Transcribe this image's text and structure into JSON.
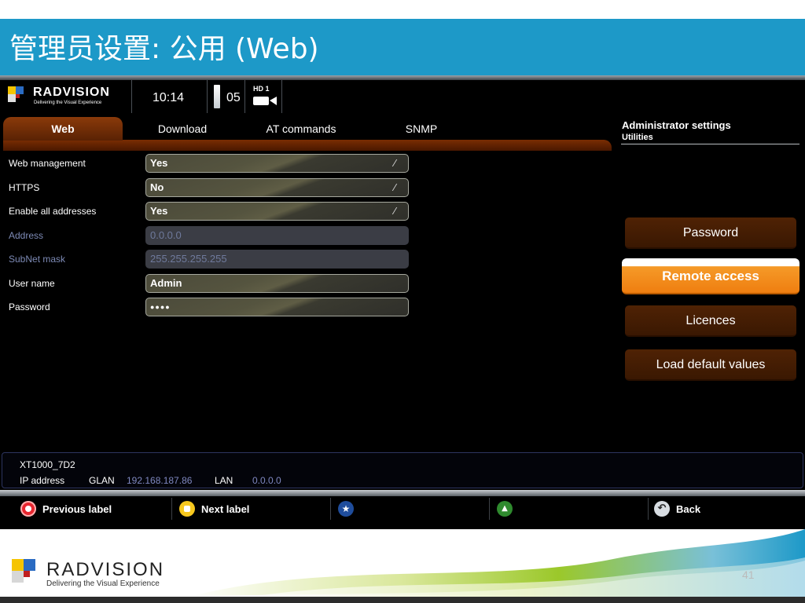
{
  "slide": {
    "title": "管理员设置: 公用 (Web)",
    "page_number": "41",
    "footer_logo": "RADVISION",
    "footer_tagline": "Delivering the Visual Experience"
  },
  "header": {
    "logo": "RADVISION",
    "tagline": "Delivering the Visual Experience",
    "time": "10:14",
    "channel": "05",
    "hd_label": "HD 1"
  },
  "tabs": [
    {
      "label": "Web",
      "active": true
    },
    {
      "label": "Download",
      "active": false
    },
    {
      "label": "AT commands",
      "active": false
    },
    {
      "label": "SNMP",
      "active": false
    }
  ],
  "admin": {
    "title": "Administrator settings",
    "subtitle": "Utilities"
  },
  "form": [
    {
      "label": "Web management",
      "value": "Yes",
      "dropdown": true,
      "disabled": false
    },
    {
      "label": "HTTPS",
      "value": "No",
      "dropdown": true,
      "disabled": false
    },
    {
      "label": "Enable all addresses",
      "value": "Yes",
      "dropdown": true,
      "disabled": false
    },
    {
      "label": "Address",
      "value": "0.0.0.0",
      "dropdown": false,
      "disabled": true
    },
    {
      "label": "SubNet mask",
      "value": "255.255.255.255",
      "dropdown": false,
      "disabled": true
    },
    {
      "label": "User name",
      "value": "Admin",
      "dropdown": false,
      "disabled": false
    },
    {
      "label": "Password",
      "value": "●●●●",
      "dropdown": false,
      "disabled": false
    }
  ],
  "menu": [
    {
      "label": "Password",
      "active": false
    },
    {
      "label": "Remote access",
      "active": true
    },
    {
      "label": "Licences",
      "active": false
    },
    {
      "label": "Load default values",
      "active": false
    }
  ],
  "status": {
    "device": "XT1000_7D2",
    "ip_label": "IP address",
    "glan_label": "GLAN",
    "glan_ip": "192.168.187.86",
    "lan_label": "LAN",
    "lan_ip": "0.0.0.0"
  },
  "softkeys": {
    "red": "Previous label",
    "yellow": "Next label",
    "blue": "",
    "green": "",
    "back": "Back"
  },
  "colors": {
    "title_bar": "#1d99c8",
    "tab_brown": "#5a2204",
    "active_orange": "#ef7e10",
    "key_red": "#e8262f",
    "key_yellow": "#f7c81e",
    "key_blue": "#1f4d9c",
    "key_green": "#2f8a2e"
  }
}
